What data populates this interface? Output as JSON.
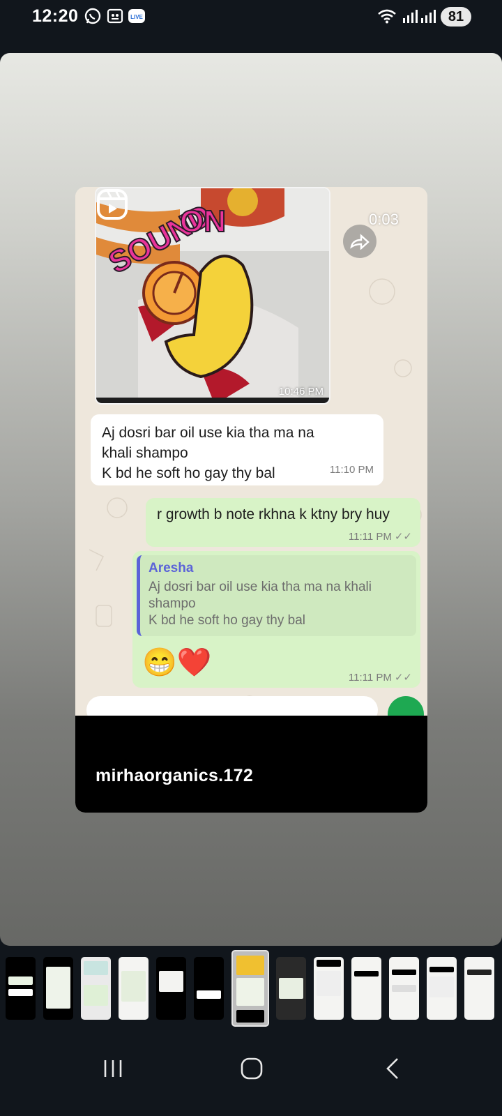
{
  "status_bar": {
    "time": "12:20",
    "battery": "81",
    "icons": [
      "whatsapp-icon",
      "screenshot-icon",
      "live-badge-icon",
      "wifi-icon",
      "signal-icon",
      "signal-icon"
    ]
  },
  "post": {
    "video": {
      "duration": "0:03",
      "thumb_time": "10:46 PM",
      "sticker_text": "SOUND ON"
    },
    "messages": {
      "incoming": {
        "text": "Aj dosri bar oil use kia tha ma na\nkhali shampo\nK bd he soft ho gay thy bal",
        "time": "11:10 PM"
      },
      "outgoing1": {
        "text": "r growth b note rkhna k ktny bry huy",
        "time": "11:11 PM"
      },
      "outgoing2": {
        "quote_name": "Aresha",
        "quote_text": "Aj dosri bar oil use kia tha ma na khali\nshampo\nK bd he soft ho gay thy bal",
        "emoji": "😁❤️",
        "time": "11:11 PM"
      }
    },
    "username": "mirhaorganics.172"
  },
  "thumbnails": {
    "count": 13,
    "active_index": 6
  },
  "colors": {
    "incoming_bubble": "#ffffff",
    "outgoing_bubble": "#d8f3c7",
    "quote_accent": "#5b63d8",
    "whatsapp_green": "#1ea952"
  }
}
